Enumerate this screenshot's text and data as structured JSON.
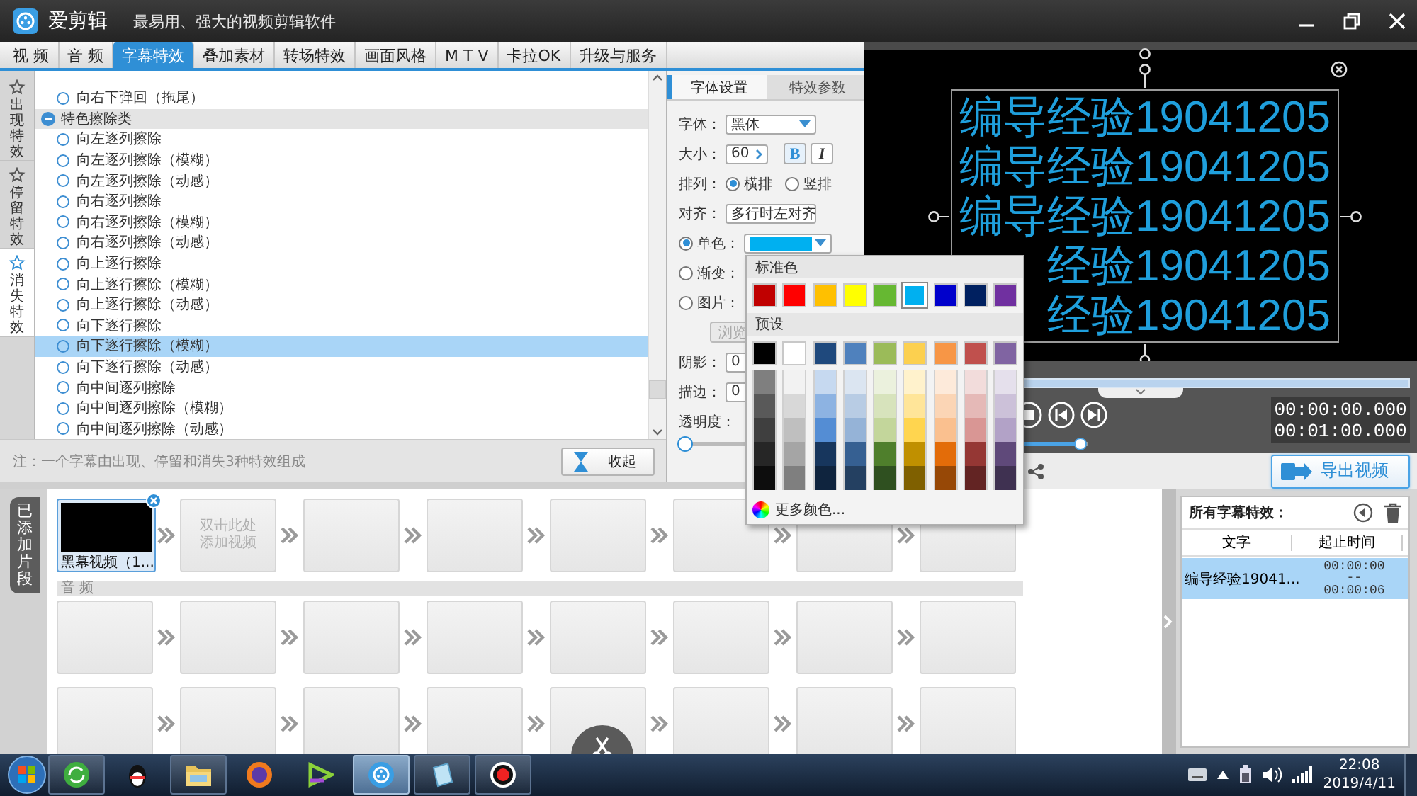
{
  "app": {
    "name": "爱剪辑",
    "tagline": "最易用、强大的视频剪辑软件"
  },
  "tabs": [
    {
      "label": "视 频",
      "selected": false
    },
    {
      "label": "音 频",
      "selected": false
    },
    {
      "label": "字幕特效",
      "selected": true
    },
    {
      "label": "叠加素材",
      "selected": false
    },
    {
      "label": "转场特效",
      "selected": false
    },
    {
      "label": "画面风格",
      "selected": false
    },
    {
      "label": "M T V",
      "selected": false
    },
    {
      "label": "卡拉OK",
      "selected": false
    },
    {
      "label": "升级与服务",
      "selected": false
    }
  ],
  "effect_categories": [
    {
      "label": "出现特效",
      "selected": false
    },
    {
      "label": "停留特效",
      "selected": false
    },
    {
      "label": "消失特效",
      "selected": true
    }
  ],
  "effect_list": [
    {
      "kind": "item",
      "label": "向右下弹回（拖尾）",
      "selected": false
    },
    {
      "kind": "group",
      "label": "特色擦除类",
      "expanded": true
    },
    {
      "kind": "item",
      "label": "向左逐列擦除",
      "selected": false
    },
    {
      "kind": "item",
      "label": "向左逐列擦除（模糊）",
      "selected": false
    },
    {
      "kind": "item",
      "label": "向左逐列擦除（动感）",
      "selected": false
    },
    {
      "kind": "item",
      "label": "向右逐列擦除",
      "selected": false
    },
    {
      "kind": "item",
      "label": "向右逐列擦除（模糊）",
      "selected": false
    },
    {
      "kind": "item",
      "label": "向右逐列擦除（动感）",
      "selected": false
    },
    {
      "kind": "item",
      "label": "向上逐行擦除",
      "selected": false
    },
    {
      "kind": "item",
      "label": "向上逐行擦除（模糊）",
      "selected": false
    },
    {
      "kind": "item",
      "label": "向上逐行擦除（动感）",
      "selected": false
    },
    {
      "kind": "item",
      "label": "向下逐行擦除",
      "selected": false
    },
    {
      "kind": "item",
      "label": "向下逐行擦除（模糊）",
      "selected": true
    },
    {
      "kind": "item",
      "label": "向下逐行擦除（动感）",
      "selected": false
    },
    {
      "kind": "item",
      "label": "向中间逐列擦除",
      "selected": false
    },
    {
      "kind": "item",
      "label": "向中间逐列擦除（模糊）",
      "selected": false
    },
    {
      "kind": "item",
      "label": "向中间逐列擦除（动感）",
      "selected": false
    }
  ],
  "note": {
    "text": "注：一个字幕由出现、停留和消失3种特效组成",
    "button": "收起"
  },
  "font_panel": {
    "tabs": [
      {
        "label": "字体设置",
        "selected": true
      },
      {
        "label": "特效参数",
        "selected": false
      }
    ],
    "font": {
      "label": "字体：",
      "value": "黑体"
    },
    "size": {
      "label": "大小：",
      "value": "60"
    },
    "bold": {
      "text": "B",
      "on": true
    },
    "italic": {
      "text": "I",
      "on": false
    },
    "layout": {
      "label": "排列：",
      "options": [
        {
          "label": "横排",
          "selected": true
        },
        {
          "label": "竖排",
          "selected": false
        }
      ]
    },
    "align": {
      "label": "对齐：",
      "value": "多行时左对齐"
    },
    "fill_options": [
      {
        "kind": "color",
        "label": "单色：",
        "selected": true,
        "color": "#00b0f0"
      },
      {
        "kind": "gradient",
        "label": "渐变：",
        "selected": false
      },
      {
        "kind": "image",
        "label": "图片：",
        "selected": false,
        "button": {
          "label": "浏览",
          "disabled": true
        }
      }
    ],
    "shadow": {
      "label": "阴影：",
      "value": "0"
    },
    "stroke": {
      "label": "描边：",
      "value": "0"
    },
    "opacity": {
      "label": "透明度：",
      "level": 0
    }
  },
  "color_popup": {
    "standard_title": "标准色",
    "standard_colors": [
      {
        "color": "#c00000",
        "selected": false
      },
      {
        "color": "#ff0000",
        "selected": false
      },
      {
        "color": "#ffc000",
        "selected": false
      },
      {
        "color": "#ffff00",
        "selected": false
      },
      {
        "color": "#66b832",
        "selected": false
      },
      {
        "color": "#00b0f0",
        "selected": true
      },
      {
        "color": "#0000cc",
        "selected": false
      },
      {
        "color": "#002060",
        "selected": false
      },
      {
        "color": "#7030a0",
        "selected": false
      }
    ],
    "preset_title": "预设",
    "presets": [
      {
        "color": "#000000",
        "shades": [
          {
            "color": "#7f7f7f"
          },
          {
            "color": "#595959"
          },
          {
            "color": "#3f3f3f"
          },
          {
            "color": "#262626"
          },
          {
            "color": "#0d0d0d"
          }
        ]
      },
      {
        "color": "#ffffff",
        "shades": [
          {
            "color": "#f2f2f2"
          },
          {
            "color": "#d8d8d8"
          },
          {
            "color": "#bfbfbf"
          },
          {
            "color": "#a5a5a5"
          },
          {
            "color": "#7f7f7f"
          }
        ]
      },
      {
        "color": "#1f497d",
        "shades": [
          {
            "color": "#c6d9f0"
          },
          {
            "color": "#8db3e2"
          },
          {
            "color": "#548dd4"
          },
          {
            "color": "#17365d"
          },
          {
            "color": "#0f243e"
          }
        ]
      },
      {
        "color": "#4f81bd",
        "shades": [
          {
            "color": "#dbe5f1"
          },
          {
            "color": "#b8cce4"
          },
          {
            "color": "#95b3d7"
          },
          {
            "color": "#366092"
          },
          {
            "color": "#244061"
          }
        ]
      },
      {
        "color": "#9bbb59",
        "shades": [
          {
            "color": "#ebf1dd"
          },
          {
            "color": "#d7e3bc"
          },
          {
            "color": "#c3d69b"
          },
          {
            "color": "#4f7f2c"
          },
          {
            "color": "#2f5020"
          }
        ]
      },
      {
        "color": "#fcd04f",
        "shades": [
          {
            "color": "#fff2cc"
          },
          {
            "color": "#ffe599"
          },
          {
            "color": "#ffd54f"
          },
          {
            "color": "#c09000"
          },
          {
            "color": "#7f6000"
          }
        ]
      },
      {
        "color": "#f79646",
        "shades": [
          {
            "color": "#fdeada"
          },
          {
            "color": "#fbd5b5"
          },
          {
            "color": "#fac08f"
          },
          {
            "color": "#e36c09"
          },
          {
            "color": "#974806"
          }
        ]
      },
      {
        "color": "#c0504d",
        "shades": [
          {
            "color": "#f2dcdb"
          },
          {
            "color": "#e5b9b7"
          },
          {
            "color": "#d99694"
          },
          {
            "color": "#953734"
          },
          {
            "color": "#632423"
          }
        ]
      },
      {
        "color": "#8064a2",
        "shades": [
          {
            "color": "#e5e0ec"
          },
          {
            "color": "#ccc1d9"
          },
          {
            "color": "#b2a2c7"
          },
          {
            "color": "#5f497a"
          },
          {
            "color": "#3f3151"
          }
        ]
      }
    ],
    "more_colors": "更多颜色..."
  },
  "preview": {
    "caption_lines": [
      "编导经验19041205",
      "编导经验19041205",
      "编导经验19041205",
      "经验19041205",
      "经验19041205"
    ]
  },
  "player": {
    "position": {
      "level": 1
    },
    "time_current": "00:00:00.000",
    "time_total": "00:01:00.000",
    "volume": {
      "level": 0.9
    },
    "export_button": "导出视频"
  },
  "timeline": {
    "label": "已添加片段",
    "tracks": [
      {
        "kind": "video",
        "slots": [
          {
            "kind": "clip",
            "label": "黑幕视频（1...",
            "selected": true
          },
          {
            "kind": "add",
            "label": "双击此处添加视频"
          },
          {
            "kind": "empty"
          },
          {
            "kind": "empty"
          },
          {
            "kind": "empty"
          },
          {
            "kind": "empty"
          },
          {
            "kind": "empty"
          },
          {
            "kind": "empty"
          }
        ]
      },
      {
        "kind": "audio",
        "label": "音 频",
        "slots": [
          {
            "kind": "empty"
          },
          {
            "kind": "empty"
          },
          {
            "kind": "empty"
          },
          {
            "kind": "empty"
          },
          {
            "kind": "empty"
          },
          {
            "kind": "empty"
          },
          {
            "kind": "empty"
          },
          {
            "kind": "empty"
          }
        ]
      },
      {
        "kind": "extra",
        "slots": [
          {
            "kind": "empty"
          },
          {
            "kind": "empty"
          },
          {
            "kind": "empty"
          },
          {
            "kind": "empty"
          },
          {
            "kind": "empty"
          },
          {
            "kind": "empty"
          },
          {
            "kind": "empty"
          },
          {
            "kind": "empty"
          }
        ]
      }
    ]
  },
  "subtitle_panel": {
    "title": "所有字幕特效：",
    "columns": [
      "文字",
      "起止时间"
    ],
    "rows": [
      {
        "text": "编导经验19041...",
        "start": "00:00:00",
        "separator": "--",
        "end": "00:00:06",
        "selected": true
      }
    ]
  },
  "taskbar": {
    "time": "22:08",
    "date": "2019/4/11"
  }
}
